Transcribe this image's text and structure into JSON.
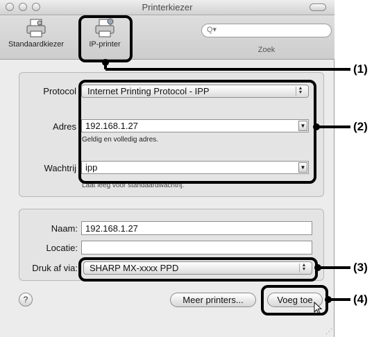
{
  "window": {
    "title": "Printerkiezer"
  },
  "toolbar": {
    "default_browser_label": "Standaardkiezer",
    "ip_printer_label": "IP-printer",
    "search_label": "Zoek",
    "search_placeholder": ""
  },
  "form": {
    "protocol_label": "Protocol",
    "protocol_value": "Internet Printing Protocol - IPP",
    "address_label": "Adres",
    "address_value": "192.168.1.27",
    "address_hint": "Geldig en volledig adres.",
    "queue_label": "Wachtrij",
    "queue_value": "ipp",
    "queue_hint": "Laat leeg voor standaardwachtrij."
  },
  "details": {
    "name_label": "Naam:",
    "name_value": "192.168.1.27",
    "location_label": "Locatie:",
    "location_value": "",
    "print_using_label": "Druk af via:",
    "print_using_value": "SHARP MX-xxxx PPD"
  },
  "footer": {
    "help_label": "?",
    "more_printers_label": "Meer printers...",
    "add_label": "Voeg toe"
  },
  "callouts": [
    "(1)",
    "(2)",
    "(3)",
    "(4)"
  ]
}
